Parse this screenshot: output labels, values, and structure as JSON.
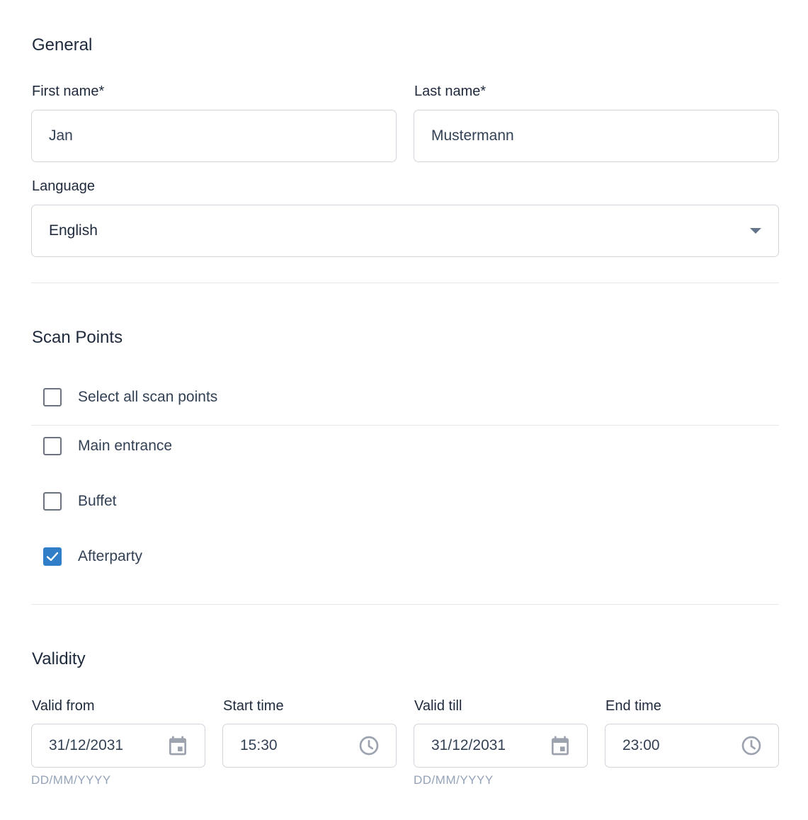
{
  "general": {
    "title": "General",
    "first_name": {
      "label": "First name*",
      "value": "Jan"
    },
    "last_name": {
      "label": "Last name*",
      "value": "Mustermann"
    },
    "language": {
      "label": "Language",
      "value": "English"
    }
  },
  "scan_points": {
    "title": "Scan Points",
    "select_all": {
      "label": "Select all scan points",
      "checked": false
    },
    "items": [
      {
        "label": "Main entrance",
        "checked": false
      },
      {
        "label": "Buffet",
        "checked": false
      },
      {
        "label": "Afterparty",
        "checked": true
      }
    ]
  },
  "validity": {
    "title": "Validity",
    "valid_from": {
      "label": "Valid from",
      "value": "31/12/2031",
      "hint": "DD/MM/YYYY",
      "icon": "calendar-icon"
    },
    "start_time": {
      "label": "Start time",
      "value": "15:30",
      "icon": "clock-icon"
    },
    "valid_till": {
      "label": "Valid till",
      "value": "31/12/2031",
      "hint": "DD/MM/YYYY",
      "icon": "calendar-icon"
    },
    "end_time": {
      "label": "End time",
      "value": "23:00",
      "icon": "clock-icon"
    }
  },
  "colors": {
    "accent": "#2f7ec7",
    "border": "#d1d5db",
    "text": "#1e293b",
    "hint": "#94a3b8"
  }
}
